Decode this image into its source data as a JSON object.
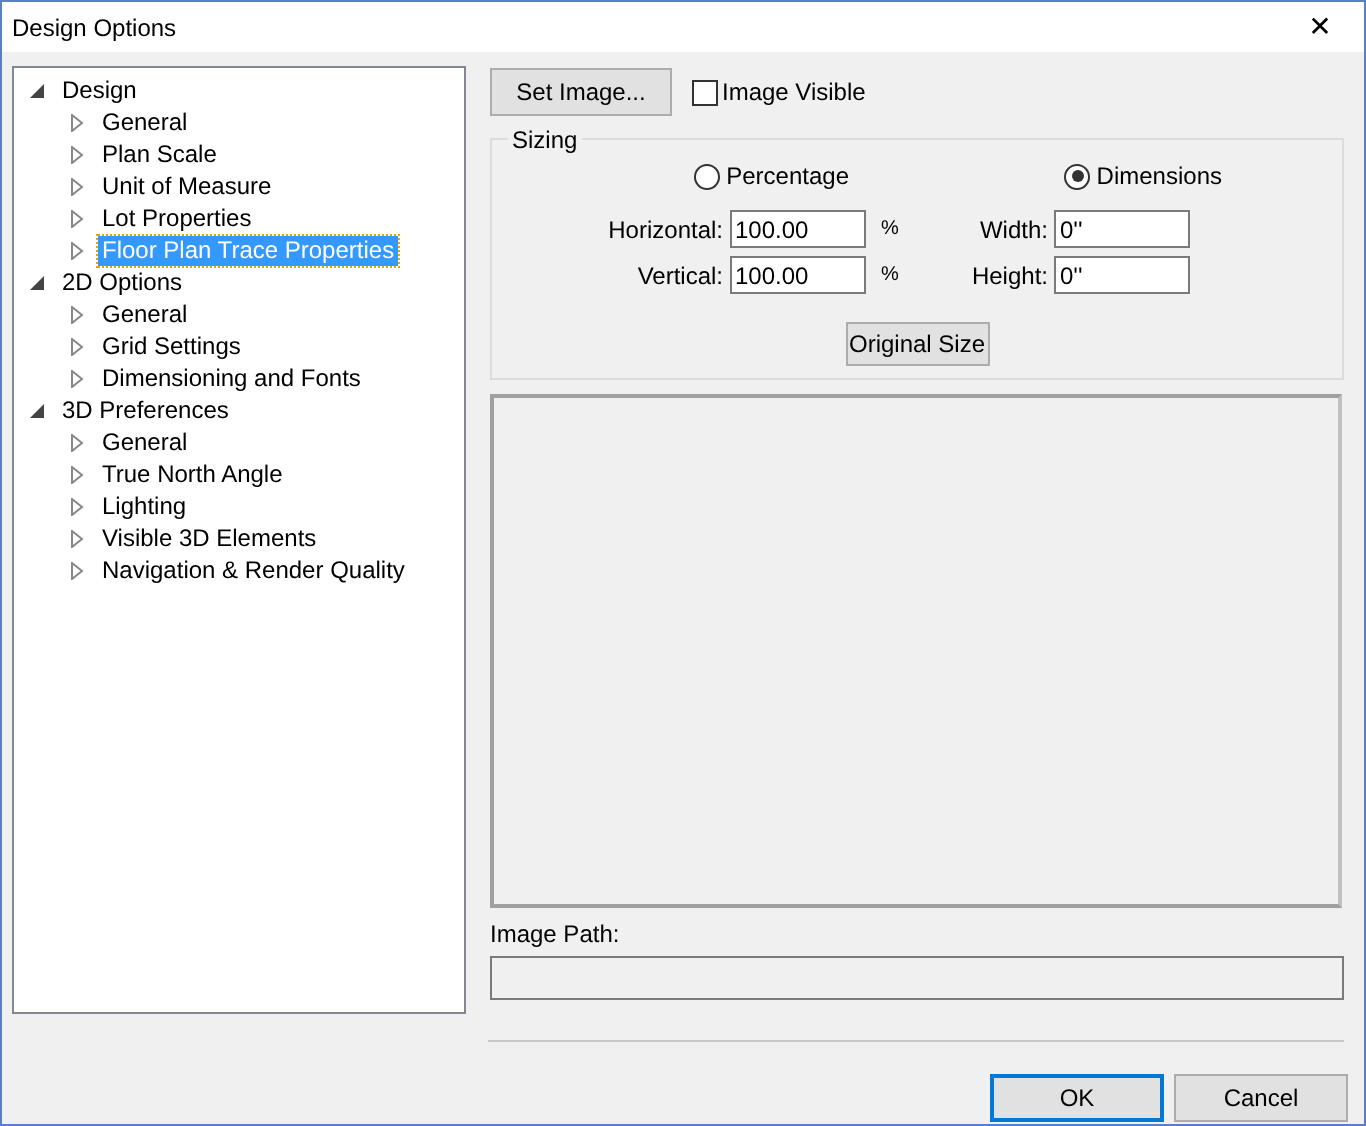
{
  "window": {
    "title": "Design Options",
    "close": "✕"
  },
  "tree": [
    {
      "label": "Design",
      "expanded": true,
      "selected": false,
      "children": [
        {
          "label": "General",
          "expanded": false,
          "selected": false
        },
        {
          "label": "Plan Scale",
          "expanded": false,
          "selected": false
        },
        {
          "label": "Unit of Measure",
          "expanded": false,
          "selected": false
        },
        {
          "label": "Lot Properties",
          "expanded": false,
          "selected": false
        },
        {
          "label": "Floor Plan Trace Properties",
          "expanded": false,
          "selected": true
        }
      ]
    },
    {
      "label": "2D Options",
      "expanded": true,
      "selected": false,
      "children": [
        {
          "label": "General",
          "expanded": false,
          "selected": false
        },
        {
          "label": "Grid Settings",
          "expanded": false,
          "selected": false
        },
        {
          "label": "Dimensioning and Fonts",
          "expanded": false,
          "selected": false
        }
      ]
    },
    {
      "label": "3D Preferences",
      "expanded": true,
      "selected": false,
      "children": [
        {
          "label": "General",
          "expanded": false,
          "selected": false
        },
        {
          "label": "True North Angle",
          "expanded": false,
          "selected": false
        },
        {
          "label": "Lighting",
          "expanded": false,
          "selected": false
        },
        {
          "label": "Visible 3D Elements",
          "expanded": false,
          "selected": false
        },
        {
          "label": "Navigation & Render Quality",
          "expanded": false,
          "selected": false
        }
      ]
    }
  ],
  "set_image_button": "Set Image...",
  "image_visible": {
    "label": "Image Visible",
    "checked": false
  },
  "sizing": {
    "title": "Sizing",
    "modes": [
      {
        "label": "Percentage",
        "selected": false
      },
      {
        "label": "Dimensions",
        "selected": true
      }
    ],
    "left_fields": [
      {
        "label": "Horizontal:",
        "value": "100.00",
        "unit": "%"
      },
      {
        "label": "Vertical:",
        "value": "100.00",
        "unit": "%"
      }
    ],
    "right_fields": [
      {
        "label": "Width:",
        "value": "0''"
      },
      {
        "label": "Height:",
        "value": "0''"
      }
    ],
    "original_size_button": "Original Size"
  },
  "image_path": {
    "label": "Image Path:"
  },
  "buttons": [
    {
      "label": "OK",
      "default": true
    },
    {
      "label": "Cancel",
      "default": false
    }
  ]
}
